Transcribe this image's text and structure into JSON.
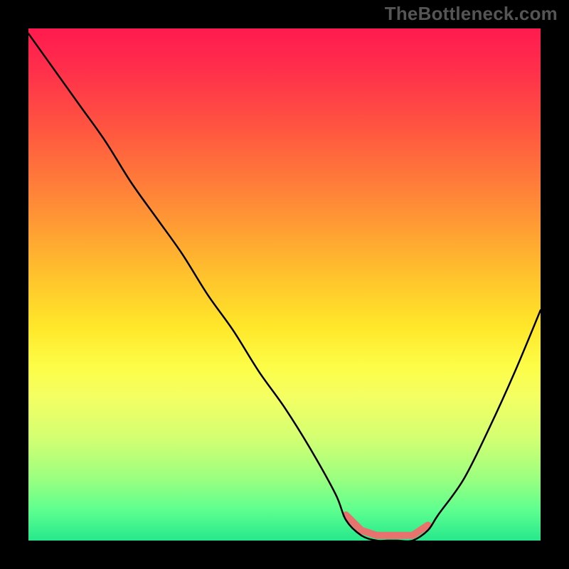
{
  "watermark": "TheBottleneck.com",
  "chart_data": {
    "type": "line",
    "title": "",
    "xlabel": "",
    "ylabel": "",
    "xlim": [
      0,
      100
    ],
    "ylim": [
      0,
      100
    ],
    "x": [
      0,
      5,
      10,
      15,
      20,
      25,
      30,
      35,
      40,
      45,
      50,
      55,
      60,
      62,
      65,
      68,
      70,
      72,
      75,
      78,
      80,
      85,
      90,
      95,
      100
    ],
    "y": [
      99,
      92,
      85,
      78,
      70,
      63,
      56,
      48,
      41,
      33,
      26,
      18,
      9,
      4,
      1,
      0,
      0,
      0,
      0,
      2,
      5,
      12,
      22,
      33,
      45
    ],
    "background_gradient_stops": [
      {
        "pos": 0,
        "color": "#ff1a4f"
      },
      {
        "pos": 0.2,
        "color": "#ff5740"
      },
      {
        "pos": 0.48,
        "color": "#ffc12d"
      },
      {
        "pos": 0.66,
        "color": "#fdfd47"
      },
      {
        "pos": 0.88,
        "color": "#9aff80"
      },
      {
        "pos": 1.0,
        "color": "#26e88c"
      }
    ],
    "highlight_band": {
      "x_start": 62,
      "x_end": 78,
      "color": "#e8736e"
    }
  }
}
